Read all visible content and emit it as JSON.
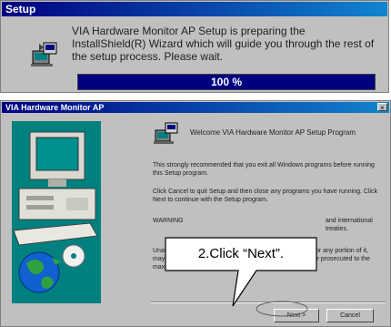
{
  "setup": {
    "title": "Setup",
    "message": "VIA Hardware Monitor AP Setup is preparing the InstallShield(R) Wizard which will guide you through the rest of the setup process.  Please wait.",
    "progress_value": 100,
    "progress_text": "100 %",
    "icon": "installer-icon"
  },
  "wizard": {
    "title": "VIA Hardware Monitor AP",
    "close_label": "×",
    "welcome": "Welcome VIA Hardware Monitor AP Setup Program",
    "para1": "This strongly recommended that you exit all Windows programs before running this Setup program.",
    "para2": "Click Cancel to quit Setup and then close any programs you have running. Click Next to continue with the Setup program.",
    "para3_start": "WARNING",
    "para3_end": "and international treaties.",
    "para4": "Unauthorized reproduction or distribution of this program, or any portion of it, may result in severe civil and criminal penalties, and will be prosecuted to the maximum extent possible under law.",
    "next_label": "Next >",
    "cancel_label": "Cancel"
  },
  "callout": {
    "text": "2.Click “Next”."
  },
  "colors": {
    "title_bar": "#000080",
    "dialog_bg": "#c0c0c0",
    "side_panel": "#00807f"
  }
}
